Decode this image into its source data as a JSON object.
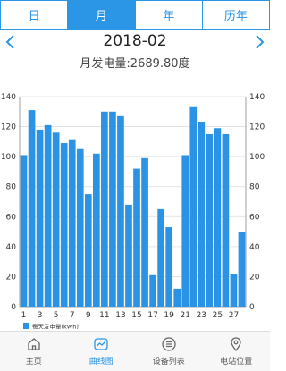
{
  "tabs": [
    {
      "label": "日"
    },
    {
      "label": "月"
    },
    {
      "label": "年"
    },
    {
      "label": "历年"
    }
  ],
  "period_label": "2018-02",
  "summary_text": "月发电量:2689.80度",
  "colors": {
    "accent": "#2c96e6",
    "bar": "#2a93e5"
  },
  "chart_data": {
    "type": "bar",
    "categories": [
      1,
      2,
      3,
      4,
      5,
      6,
      7,
      8,
      9,
      10,
      11,
      12,
      13,
      14,
      15,
      16,
      17,
      18,
      19,
      20,
      21,
      22,
      23,
      24,
      25,
      26,
      27,
      28
    ],
    "x_tick_labels": [
      "1",
      "3",
      "5",
      "7",
      "9",
      "11",
      "13",
      "15",
      "17",
      "19",
      "21",
      "23",
      "25",
      "27"
    ],
    "series": [
      {
        "name": "每天发电量(kWh)",
        "values": [
          101,
          131,
          118,
          121,
          116,
          109,
          111,
          105,
          75,
          102,
          130,
          130,
          127,
          68,
          92,
          99,
          21,
          65,
          53,
          12,
          101,
          133,
          123,
          115,
          119,
          115,
          22,
          50
        ]
      }
    ],
    "ylim": [
      0,
      140
    ],
    "y_ticks": [
      0,
      20,
      40,
      60,
      80,
      100,
      120,
      140
    ],
    "grid": true,
    "legend_position": "bottom-left",
    "dual_y_axis": true
  },
  "bottom_nav": [
    {
      "label": "主页",
      "icon": "home-icon"
    },
    {
      "label": "曲线图",
      "icon": "chart-icon"
    },
    {
      "label": "设备列表",
      "icon": "list-icon"
    },
    {
      "label": "电站位置",
      "icon": "location-pin-icon"
    }
  ]
}
